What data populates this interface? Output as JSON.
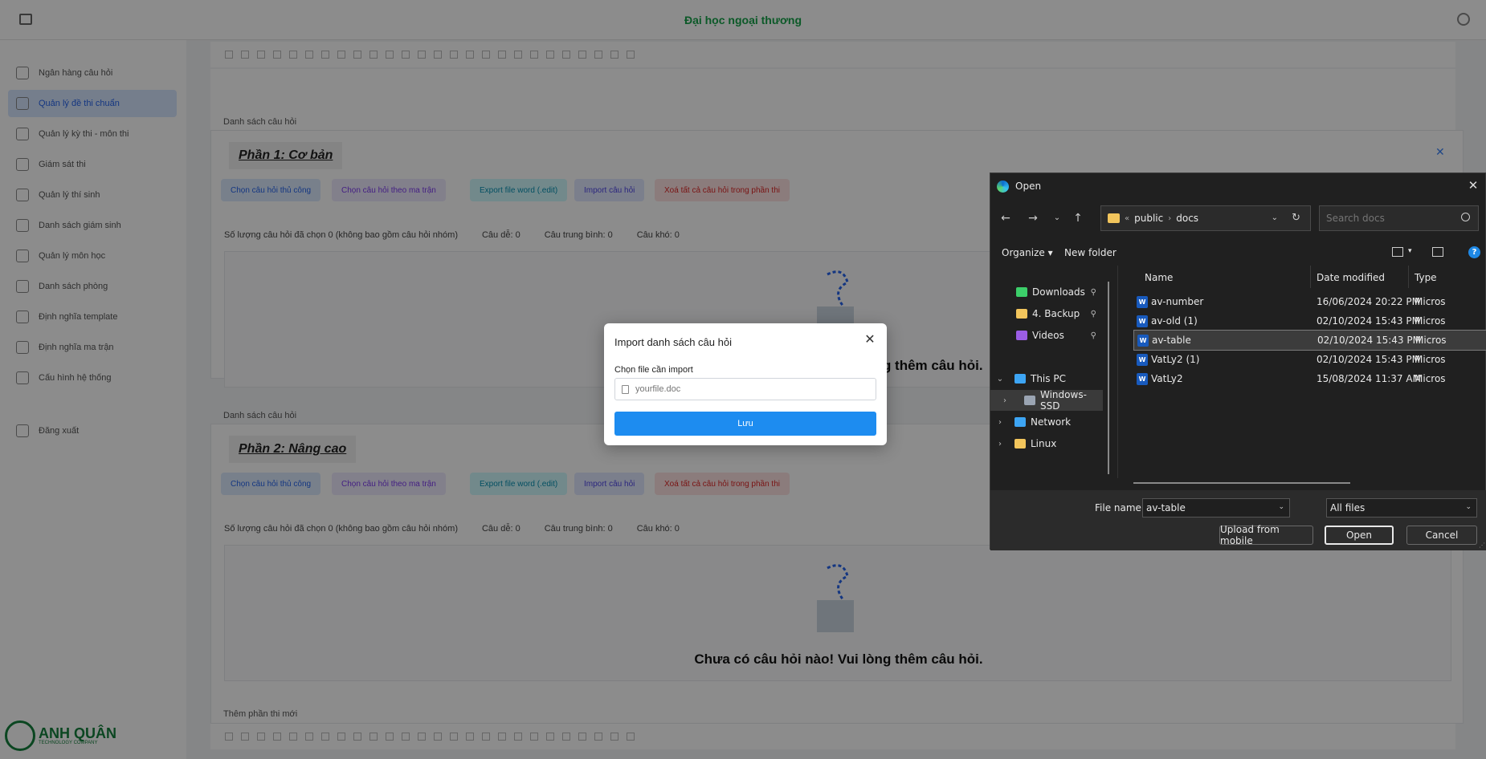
{
  "app": {
    "title": "Đại học ngoại thương",
    "sidebar": [
      {
        "label": "Ngân hàng câu hỏi"
      },
      {
        "label": "Quản lý đề thi chuẩn",
        "active": true
      },
      {
        "label": "Quản lý kỳ thi - môn thi"
      },
      {
        "label": "Giám sát thi"
      },
      {
        "label": "Quản lý thí sinh"
      },
      {
        "label": "Danh sách giám sinh"
      },
      {
        "label": "Quản lý môn học"
      },
      {
        "label": "Danh sách phòng"
      },
      {
        "label": "Định nghĩa template"
      },
      {
        "label": "Định nghĩa ma trận"
      },
      {
        "label": "Cấu hình hệ thống"
      },
      {
        "label": "Đăng xuất"
      }
    ],
    "logo": {
      "name": "ANH QUÂN",
      "sub": "TECHNOLOGY COMPANY"
    },
    "section_label": "Danh sách câu hỏi",
    "add_part_label": "Thêm phần thi mới",
    "parts": [
      {
        "title": "Phần 1: Cơ bản"
      },
      {
        "title": "Phần 2: Nâng cao"
      }
    ],
    "actions": {
      "choose_bank": "Chọn câu hỏi thủ công",
      "choose_matrix": "Chọn câu hỏi theo ma trận",
      "export_word": "Export file word (.edit)",
      "import": "Import câu hỏi",
      "delete_all": "Xoá tất cả câu hỏi trong phần thi"
    },
    "stats": {
      "selected": "Số lượng câu hỏi đã chọn 0 (không bao gồm câu hỏi nhóm)",
      "easy": "Câu dễ: 0",
      "medium": "Câu trung bình: 0",
      "hard": "Câu khó: 0"
    },
    "empty_message": "Chưa có câu hỏi nào! Vui lòng thêm câu hỏi."
  },
  "modal": {
    "title": "Import danh sách câu hỏi",
    "label": "Chọn file cần import",
    "placeholder": "yourfile.doc",
    "save": "Lưu"
  },
  "dialog": {
    "title": "Open",
    "path": [
      "public",
      "docs"
    ],
    "path_prefix": "«",
    "search_placeholder": "Search docs",
    "organize": "Organize",
    "new_folder": "New folder",
    "help": "?",
    "nav": [
      {
        "label": "Downloads",
        "pinned": true,
        "color": "#3ccf6a"
      },
      {
        "label": "4. Backup",
        "pinned": true,
        "color": "#f2c55c"
      },
      {
        "label": "Videos",
        "pinned": true,
        "color": "#9b5de5"
      },
      {
        "label": "This PC",
        "expanded": true,
        "color": "#3da5f4"
      },
      {
        "label": "Windows-SSD",
        "selected": true,
        "color": "#9aa4b2"
      },
      {
        "label": "Network",
        "color": "#3da5f4"
      },
      {
        "label": "Linux",
        "color": "#f2c55c"
      }
    ],
    "columns": {
      "name": "Name",
      "date": "Date modified",
      "type": "Type"
    },
    "files": [
      {
        "name": "av-number",
        "date": "16/06/2024 20:22 PM",
        "type": "Micros"
      },
      {
        "name": "av-old (1)",
        "date": "02/10/2024 15:43 PM",
        "type": "Micros"
      },
      {
        "name": "av-table",
        "date": "02/10/2024 15:43 PM",
        "type": "Micros",
        "selected": true
      },
      {
        "name": "VatLy2 (1)",
        "date": "02/10/2024 15:43 PM",
        "type": "Micros"
      },
      {
        "name": "VatLy2",
        "date": "15/08/2024 11:37 AM",
        "type": "Micros"
      }
    ],
    "file_name_label": "File name:",
    "file_name_value": "av-table",
    "file_type": "All files",
    "buttons": {
      "upload": "Upload from mobile",
      "open": "Open",
      "cancel": "Cancel"
    }
  }
}
